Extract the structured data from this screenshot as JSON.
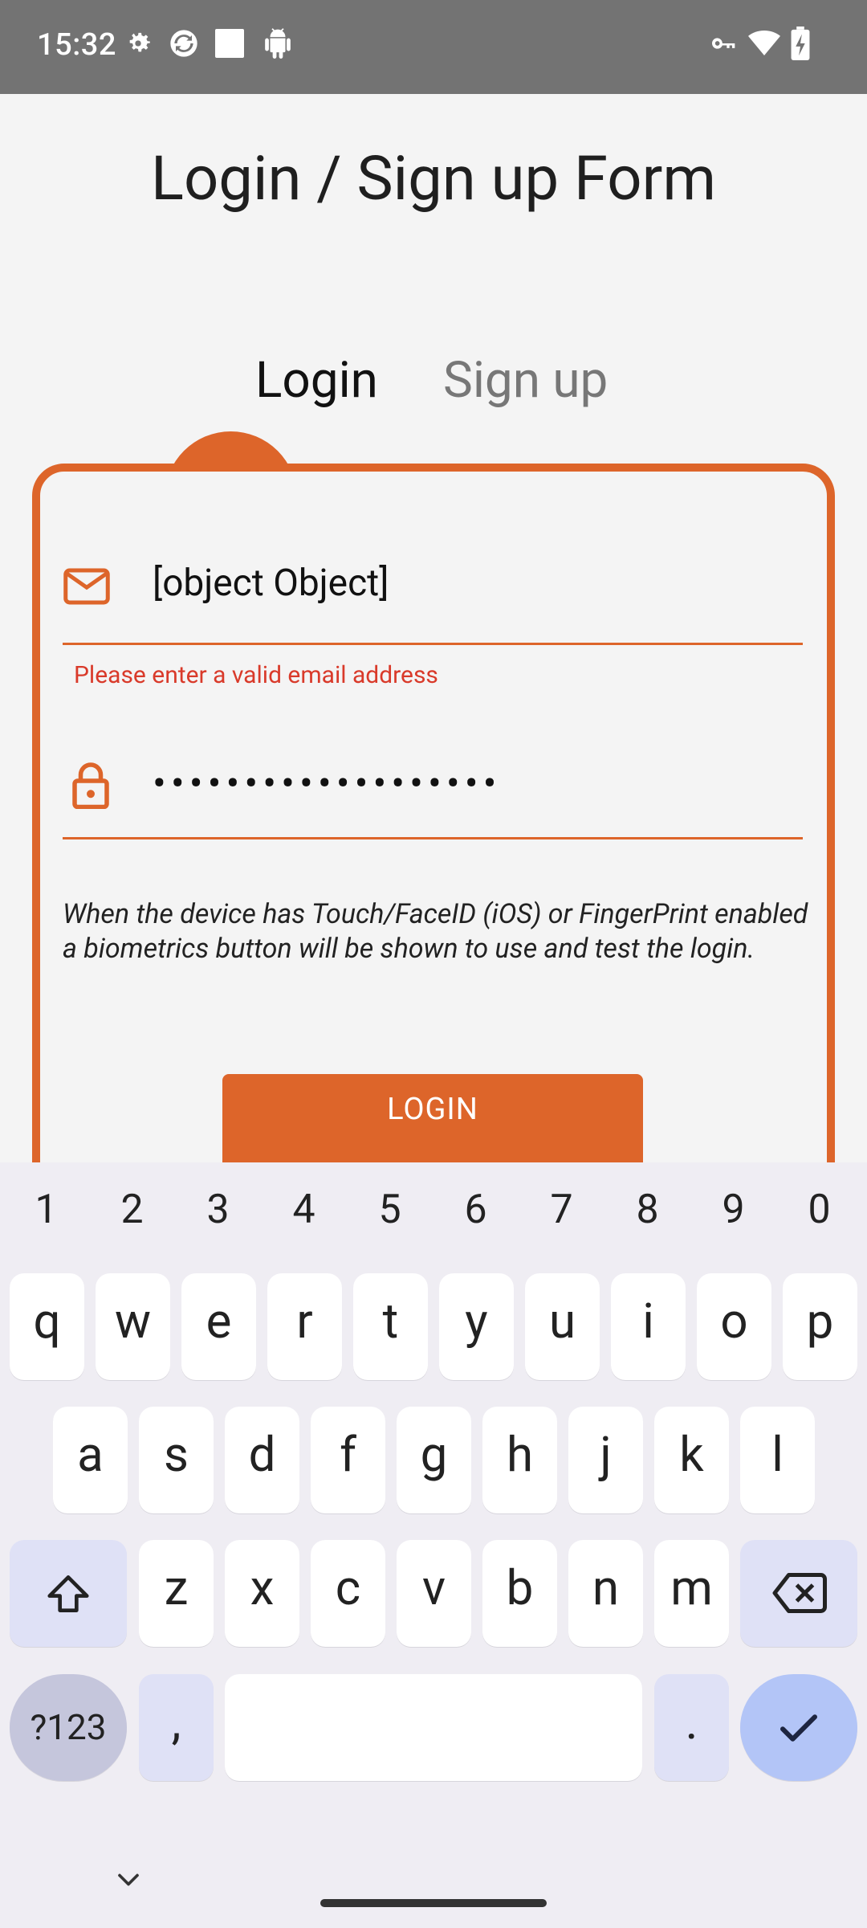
{
  "status_bar": {
    "time": "15:32",
    "icons": [
      "settings-icon",
      "sync-icon",
      "square-icon",
      "android-icon",
      "key-icon",
      "wifi-icon",
      "battery-icon"
    ]
  },
  "app": {
    "title": "Login / Sign up Form",
    "tabs": [
      {
        "label": "Login",
        "active": true
      },
      {
        "label": "Sign up",
        "active": false
      }
    ],
    "email": {
      "value": "[object Object]",
      "error": "Please enter a valid email address",
      "icon": "mail-icon"
    },
    "password": {
      "value": "•••••••••••••••••••",
      "icon": "lock-icon"
    },
    "note": "When the device has Touch/FaceID (iOS) or FingerPrint enabled a biometrics button will be shown to use and test the login.",
    "login_button": "LOGIN",
    "accent": "#dd652a",
    "error_color": "#d93a2a"
  },
  "keyboard": {
    "numbers": [
      "1",
      "2",
      "3",
      "4",
      "5",
      "6",
      "7",
      "8",
      "9",
      "0"
    ],
    "row1": [
      "q",
      "w",
      "e",
      "r",
      "t",
      "y",
      "u",
      "i",
      "o",
      "p"
    ],
    "row2": [
      "a",
      "s",
      "d",
      "f",
      "g",
      "h",
      "j",
      "k",
      "l"
    ],
    "row3": [
      "z",
      "x",
      "c",
      "v",
      "b",
      "n",
      "m"
    ],
    "symbols_label": "?123",
    "comma": ",",
    "period": "."
  }
}
